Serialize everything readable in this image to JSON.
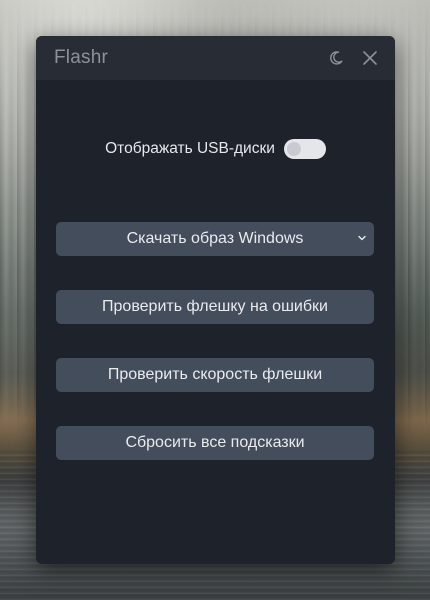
{
  "window": {
    "title": "Flashr"
  },
  "titlebar_icons": {
    "theme": "moon-icon",
    "close": "close-icon"
  },
  "settings": {
    "show_usb_label": "Отображать USB-диски",
    "show_usb_enabled": false
  },
  "actions": {
    "download_windows_label": "Скачать образ Windows",
    "check_errors_label": "Проверить флешку на ошибки",
    "check_speed_label": "Проверить скорость флешки",
    "reset_hints_label": "Сбросить все подсказки"
  },
  "colors": {
    "window_bg": "#1e222a",
    "titlebar_bg": "#282c34",
    "button_bg": "#444d5c",
    "text": "#e6e8ec",
    "title_text": "#8b929e"
  }
}
